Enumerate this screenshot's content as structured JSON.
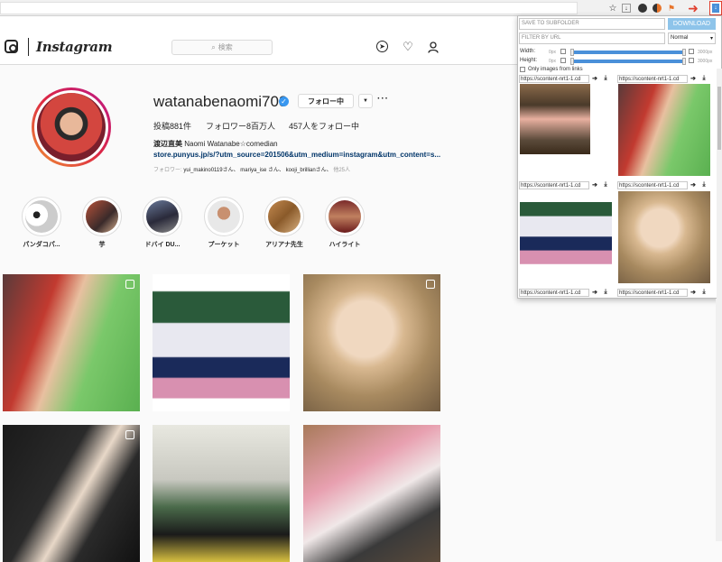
{
  "browser": {
    "extension_icons": [
      "star-icon",
      "download-icon",
      "dark-circle-icon",
      "pie-icon",
      "flag-icon",
      "arrow-icon"
    ],
    "highlight_color": "#e04030"
  },
  "instagram": {
    "wordmark": "Instagram",
    "search_placeholder": "検索",
    "accent": "#3897f0"
  },
  "profile": {
    "username": "watanabenaomi703",
    "follow_label": "フォロー中",
    "posts": "投稿881件",
    "followers": "フォロワー8百万人",
    "following": "457人をフォロー中",
    "full_name": "渡辺直美",
    "bio": "Naomi Watanabe☆comedian",
    "link": "store.punyus.jp/s/?utm_source=201506&utm_medium=instagram&utm_content=s...",
    "followed_by_prefix": "フォロワー: ",
    "followed_by": [
      "yui_makino0119さん、",
      "mariya_ise さん、",
      "kooji_brillianさん、"
    ],
    "followed_by_suffix": "他25人"
  },
  "highlights": [
    {
      "label": "パンダコパ..."
    },
    {
      "label": "芋"
    },
    {
      "label": "ドバイ DU..."
    },
    {
      "label": "プーケット"
    },
    {
      "label": "アリアナ先生"
    },
    {
      "label": "ハイライト"
    }
  ],
  "extension": {
    "subfolder_placeholder": "SAVE TO SUBFOLDER",
    "download_label": "DOWNLOAD",
    "filter_placeholder": "FILTER BY URL",
    "mode": "Normal",
    "width_label": "Width:",
    "height_label": "Height:",
    "min_label": "0px",
    "max_label": "3000px",
    "only_images_label": "Only images from links",
    "url_text": "https://scontent-nrt1-1.cd",
    "go_arrow": "➔",
    "download_arrow": "⤓"
  }
}
